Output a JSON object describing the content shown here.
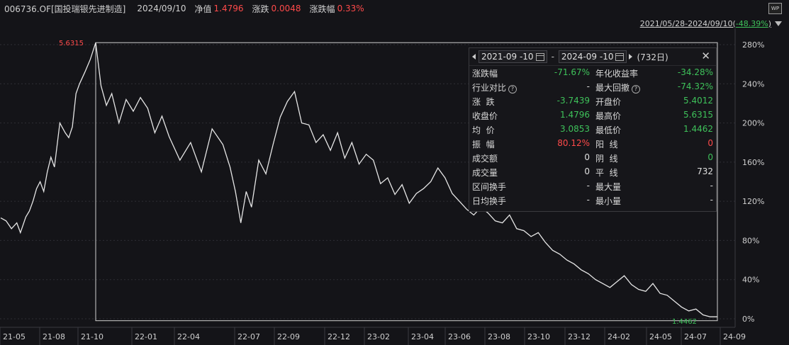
{
  "header": {
    "code": "006736.OF[国投瑞银先进制造]",
    "date": "2024/09/10",
    "nav_label": "净值",
    "nav_value": "1.4796",
    "change_label": "涨跌",
    "change_value": "0.0048",
    "pct_label": "涨跌幅",
    "pct_value": "0.33%",
    "wp_label": "WP"
  },
  "range": {
    "text": "2021/05/28-2024/09/10(",
    "pct": "-48.39%",
    "close_paren": ")"
  },
  "colors": {
    "background": "#141418",
    "line": "#e6e6e6",
    "up": "#ff4a4a",
    "down": "#3ec25a",
    "grid": "#2e2e34"
  },
  "chart_data": {
    "type": "line",
    "x_tick_labels": [
      "21-05",
      "21-08",
      "21-10",
      "22-01",
      "22-04",
      "22-07",
      "22-09",
      "22-12",
      "23-02",
      "23-04",
      "23-06",
      "23-08",
      "23-10",
      "23-12",
      "24-02",
      "24-05",
      "24-07",
      "24-09"
    ],
    "y_tick_labels": [
      "280%",
      "240%",
      "200%",
      "160%",
      "120%",
      "80%",
      "40%",
      "0%"
    ],
    "ylim": [
      -2,
      282
    ],
    "y_unit": "percent",
    "max_label": "5.6315",
    "min_label": "1.4462",
    "series": [
      {
        "t": [
          0,
          1.5,
          3,
          4.5,
          5.5,
          7,
          8,
          9,
          10,
          11,
          12,
          13,
          14,
          15,
          16.5,
          18,
          19,
          20,
          21,
          22,
          23.5,
          25,
          26.5,
          28,
          29.5,
          31,
          33,
          35,
          37,
          39,
          41,
          43,
          45,
          47,
          50,
          53,
          56,
          59,
          62,
          64,
          65.5,
          67,
          68.5,
          70,
          72,
          74,
          76,
          78,
          80,
          82,
          84,
          86,
          88,
          90,
          92,
          94,
          96,
          98,
          100,
          102,
          104,
          106,
          108,
          110,
          112,
          114,
          116,
          118,
          120,
          122,
          124,
          126,
          128,
          130,
          132,
          134,
          136,
          138,
          140,
          142,
          144,
          146,
          148,
          150,
          152,
          154,
          156,
          158,
          160,
          162,
          164,
          166,
          168,
          170,
          172,
          174,
          176,
          178,
          180,
          182,
          184,
          186,
          188,
          190,
          192,
          194,
          196,
          198,
          200
        ],
        "y": [
          103,
          100,
          92,
          98,
          88,
          104,
          110,
          120,
          133,
          140,
          130,
          150,
          165,
          155,
          200,
          190,
          185,
          196,
          230,
          240,
          252,
          265,
          282,
          238,
          218,
          230,
          200,
          224,
          212,
          226,
          215,
          190,
          207,
          186,
          162,
          180,
          150,
          194,
          178,
          155,
          130,
          98,
          130,
          114,
          162,
          148,
          178,
          206,
          222,
          232,
          200,
          198,
          180,
          188,
          172,
          190,
          164,
          180,
          158,
          168,
          162,
          138,
          144,
          127,
          137,
          118,
          128,
          133,
          140,
          154,
          144,
          128,
          120,
          112,
          106,
          114,
          108,
          100,
          98,
          106,
          92,
          90,
          84,
          88,
          78,
          70,
          66,
          60,
          56,
          50,
          46,
          40,
          36,
          32,
          38,
          44,
          35,
          30,
          28,
          36,
          26,
          24,
          18,
          12,
          8,
          10,
          4,
          2,
          2
        ]
      }
    ]
  },
  "stats": {
    "start_date": "2021-09 -10",
    "end_date": "2024-09 -10",
    "separator": "-",
    "days": "(732日)",
    "rows": [
      {
        "l_label": "涨跌幅",
        "l_value": "-71.67%",
        "l_color": "green",
        "l_q": false,
        "r_label": "年化收益率",
        "r_value": "-34.28%",
        "r_color": "green",
        "r_q": false
      },
      {
        "l_label": "行业对比",
        "l_value": "-",
        "l_color": "white",
        "l_q": true,
        "r_label": "最大回撤",
        "r_value": "-74.32%",
        "r_color": "green",
        "r_q": true
      },
      {
        "l_label": "涨  跌",
        "l_value": "-3.7439",
        "l_color": "green",
        "l_q": false,
        "r_label": "开盘价",
        "r_value": "5.4012",
        "r_color": "green",
        "r_q": false
      },
      {
        "l_label": "收盘价",
        "l_value": "1.4796",
        "l_color": "green",
        "l_q": false,
        "r_label": "最高价",
        "r_value": "5.6315",
        "r_color": "green",
        "r_q": false
      },
      {
        "l_label": "均  价",
        "l_value": "3.0853",
        "l_color": "green",
        "l_q": false,
        "r_label": "最低价",
        "r_value": "1.4462",
        "r_color": "green",
        "r_q": false
      },
      {
        "l_label": "振  幅",
        "l_value": "80.12%",
        "l_color": "red",
        "l_q": false,
        "r_label": "阳  线",
        "r_value": "0",
        "r_color": "red",
        "r_q": false
      },
      {
        "l_label": "成交额",
        "l_value": "0",
        "l_color": "white",
        "l_q": false,
        "r_label": "阴  线",
        "r_value": "0",
        "r_color": "green",
        "r_q": false
      },
      {
        "l_label": "成交量",
        "l_value": "0",
        "l_color": "white",
        "l_q": false,
        "r_label": "平  线",
        "r_value": "732",
        "r_color": "white",
        "r_q": false
      },
      {
        "l_label": "区间换手",
        "l_value": "-",
        "l_color": "white",
        "l_q": false,
        "r_label": "最大量",
        "r_value": "-",
        "r_color": "white",
        "r_q": false
      },
      {
        "l_label": "日均换手",
        "l_value": "-",
        "l_color": "white",
        "l_q": false,
        "r_label": "最小量",
        "r_value": "-",
        "r_color": "white",
        "r_q": false
      }
    ]
  }
}
